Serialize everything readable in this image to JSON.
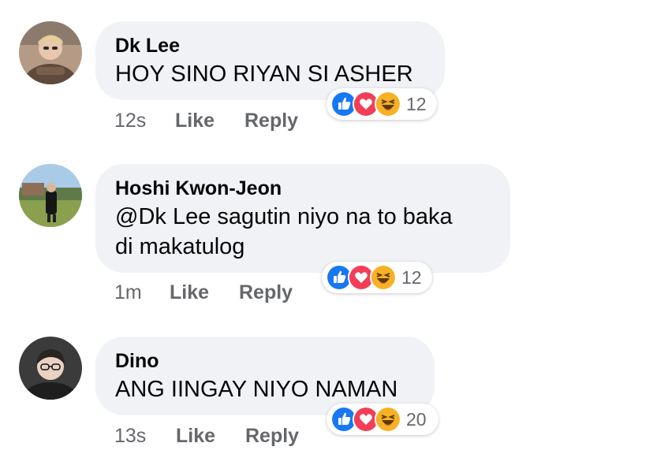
{
  "comments": [
    {
      "author": "Dk Lee",
      "text": "HOY SINO RIYAN SI ASHER",
      "time": "12s",
      "like_label": "Like",
      "reply_label": "Reply",
      "reaction_count": "12"
    },
    {
      "author": "Hoshi Kwon-Jeon",
      "text_line1": "@Dk Lee sagutin niyo na to baka",
      "text_line2": "di makatulog",
      "time": "1m",
      "like_label": "Like",
      "reply_label": "Reply",
      "reaction_count": "12"
    },
    {
      "author": "Dino",
      "text": "ANG IINGAY NIYO NAMAN",
      "time": "13s",
      "like_label": "Like",
      "reply_label": "Reply",
      "reaction_count": "20"
    }
  ],
  "reactions": [
    "like-icon",
    "love-icon",
    "haha-icon"
  ],
  "colors": {
    "bubble": "#f0f2f5",
    "like": "#1877f2",
    "love": "#f33e58",
    "haha": "#f7b125",
    "meta": "#65676b"
  }
}
